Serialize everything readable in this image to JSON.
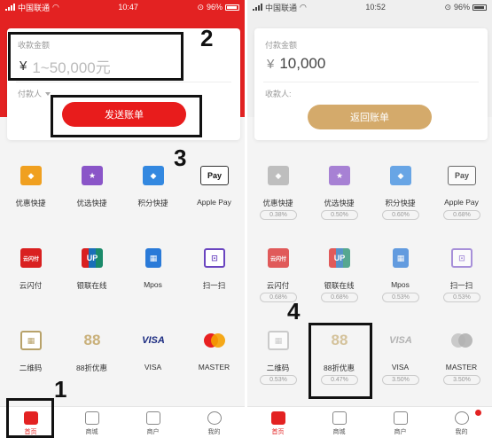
{
  "left": {
    "status": {
      "carrier": "中国联通",
      "time": "10:47",
      "battery": "96%"
    },
    "amount_label": "收款金额",
    "currency": "¥",
    "amount_placeholder": "1~50,000元",
    "payer_label": "付款人",
    "button_label": "发送账单",
    "annotations": [
      "2",
      "3",
      "1"
    ],
    "items": [
      {
        "name": "优惠快捷",
        "icon": "tag-icon",
        "color": "#f0a020"
      },
      {
        "name": "优选快捷",
        "icon": "star-icon",
        "color": "#8a55c8"
      },
      {
        "name": "积分快捷",
        "icon": "diamond-icon",
        "color": "#3388e0"
      },
      {
        "name": "Apple Pay",
        "icon": "apple-pay-icon",
        "color": "#ffffff"
      },
      {
        "name": "云闪付",
        "icon": "quickpass-icon",
        "color": "#d92020"
      },
      {
        "name": "银联在线",
        "icon": "unionpay-icon",
        "color": "#1a6fb8"
      },
      {
        "name": "Mpos",
        "icon": "pos-terminal-icon",
        "color": "#2a7ad8"
      },
      {
        "name": "扫一扫",
        "icon": "scan-icon",
        "color": "#6a45c0"
      },
      {
        "name": "二维码",
        "icon": "qr-code-icon",
        "color": "#b8a26a"
      },
      {
        "name": "88折优惠",
        "icon": "eighty-eight-icon",
        "color": "#c9b07a"
      },
      {
        "name": "VISA",
        "icon": "visa-icon",
        "color": "#1a2a80"
      },
      {
        "name": "MASTER",
        "icon": "mastercard-icon",
        "color": "#e82020"
      }
    ],
    "tabs": [
      {
        "label": "首页",
        "icon": "home-icon",
        "active": true
      },
      {
        "label": "商城",
        "icon": "shop-icon",
        "active": false
      },
      {
        "label": "商户",
        "icon": "merchant-icon",
        "active": false
      },
      {
        "label": "我的",
        "icon": "profile-icon",
        "active": false
      }
    ]
  },
  "right": {
    "status": {
      "carrier": "中国联通",
      "time": "10:52",
      "battery": "96%"
    },
    "amount_label": "付款金额",
    "currency": "¥",
    "amount_value": "10,000",
    "payer_label": "收款人:",
    "button_label": "返回账单",
    "annotations": [
      "4"
    ],
    "items": [
      {
        "name": "优惠快捷",
        "rate": "0.38%"
      },
      {
        "name": "优选快捷",
        "rate": "0.50%"
      },
      {
        "name": "积分快捷",
        "rate": "0.60%"
      },
      {
        "name": "Apple Pay",
        "rate": "0.68%"
      },
      {
        "name": "云闪付",
        "rate": "0.68%"
      },
      {
        "name": "银联在线",
        "rate": "0.68%"
      },
      {
        "name": "Mpos",
        "rate": "0.53%"
      },
      {
        "name": "扫一扫",
        "rate": "0.53%"
      },
      {
        "name": "二维码",
        "rate": "0.53%"
      },
      {
        "name": "88折优惠",
        "rate": "0.47%"
      },
      {
        "name": "VISA",
        "rate": "3.50%"
      },
      {
        "name": "MASTER",
        "rate": "3.50%"
      }
    ],
    "tabs": [
      {
        "label": "首页",
        "active": true
      },
      {
        "label": "商城",
        "active": false
      },
      {
        "label": "商户",
        "active": false
      },
      {
        "label": "我的",
        "active": false
      }
    ]
  },
  "icon_text": {
    "apple_pay": "Pay",
    "quickpass": "云闪付",
    "unionpay": "UP",
    "pos": "▦",
    "scan": "⊡",
    "qr": "▦",
    "eighty_eight": "88",
    "visa": "VISA",
    "mastercard": "●●",
    "tag": "◆",
    "star": "★",
    "diamond": "◆"
  }
}
